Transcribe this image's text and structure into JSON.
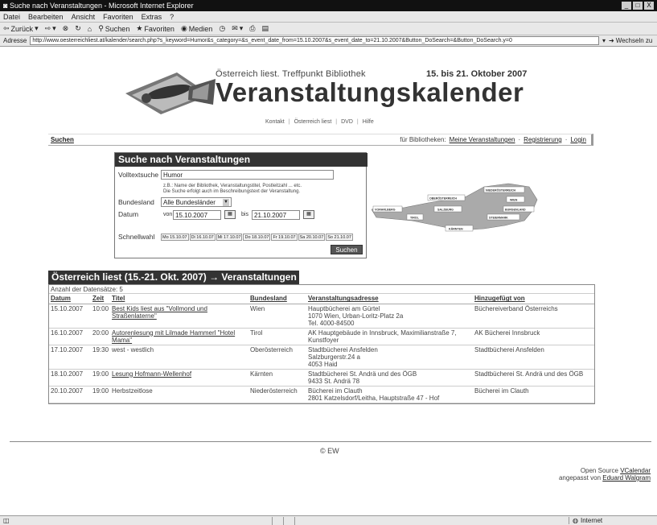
{
  "window": {
    "title": "Suche nach Veranstaltungen - Microsoft Internet Explorer",
    "controls": [
      "_",
      "□",
      "X"
    ]
  },
  "menu": [
    "Datei",
    "Bearbeiten",
    "Ansicht",
    "Favoriten",
    "Extras",
    "?"
  ],
  "toolbar": {
    "back": "Zurück",
    "search": "Suchen",
    "favorites": "Favoriten",
    "media": "Medien"
  },
  "addressbar": {
    "label": "Adresse",
    "url": "http://www.oesterreichliest.at/kalender/search.php?s_keyword=Humor&s_category=&s_event_date_from=15.10.2007&s_event_date_to=21.10.2007&Button_DoSearch=&Button_DoSearch.y=0",
    "go": "Wechseln zu"
  },
  "status": {
    "left": "",
    "zone": "Internet"
  },
  "header": {
    "subtitle": "Österreich liest. Treffpunkt Bibliothek",
    "dates": "15. bis 21. Oktober 2007",
    "title": "Veranstaltungskalender",
    "nav": [
      "Kontakt",
      "Österreich liest",
      "DVD",
      "Hilfe"
    ]
  },
  "navbar": {
    "search": "Suchen",
    "for_libraries": "für Bibliotheken:",
    "links": [
      "Meine Veranstaltungen",
      "Registrierung",
      "Login"
    ]
  },
  "search": {
    "title": "Suche nach Veranstaltungen",
    "fulltext_label": "Volltextsuche",
    "fulltext_value": "Humor",
    "hint_line1": "z.B.: Name der Bibliothek, Veranstaltungstitel, Postleitzahl ... etc.",
    "hint_line2": "Die Suche erfolgt auch im Beschreibungstext der Veranstaltung.",
    "state_label": "Bundesland",
    "state_value": "Alle Bundesländer",
    "date_label": "Datum",
    "from_label": "von",
    "from_value": "15.10.2007",
    "to_label": "bis",
    "to_value": "21.10.2007",
    "quick_label": "Schnellwahl",
    "quick_options": [
      "Mo 15.10.07",
      "Di 16.10.07",
      "Mi 17.10.07",
      "Do 18.10.07",
      "Fr 19.10.07",
      "Sa 20.10.07",
      "So 21.10.07"
    ],
    "submit": "Suchen"
  },
  "map": {
    "regions": [
      "NIEDERÖSTERREICH",
      "OBERÖSTERREICH",
      "WIEN",
      "VORARLBERG",
      "SALZBURG",
      "BURGENLAND",
      "TIROL",
      "STEIERMARK",
      "KÄRNTEN"
    ]
  },
  "results": {
    "title": "Österreich liest (15.-21. Okt. 2007) → Veranstaltungen",
    "count_label": "Anzahl der Datensätze:",
    "count": "5",
    "columns": [
      "Datum",
      "Zeit",
      "Titel",
      "Bundesland",
      "Veranstaltungsadresse",
      "Hinzugefügt von"
    ],
    "rows": [
      {
        "date": "15.10.2007",
        "time": "10:00",
        "title": "Best Kids liest aus \"Vollmond und Straßenlaterne\"",
        "title_link": true,
        "state": "Wien",
        "address": [
          "Hauptbücherei am Gürtel",
          "1070 Wien, Urban-Loritz-Platz 2a",
          "Tel. 4000-84500"
        ],
        "added_by": "Büchereiverband Österreichs"
      },
      {
        "date": "16.10.2007",
        "time": "20:00",
        "title": "Autorenlesung mit Lilmade Hammerl \"Hotel Mama\"",
        "title_link": true,
        "state": "Tirol",
        "address": [
          "AK Hauptgebäude in Innsbruck, Maximilianstraße 7,",
          "Kunstfoyer"
        ],
        "added_by": "AK Bücherei Innsbruck"
      },
      {
        "date": "17.10.2007",
        "time": "19:30",
        "title": "west - westlich",
        "title_link": false,
        "state": "Oberösterreich",
        "address": [
          "Stadtbücherei Ansfelden",
          "Salzburgerstr.24 a",
          "4053 Haid"
        ],
        "added_by": "Stadtbücherei Ansfelden"
      },
      {
        "date": "18.10.2007",
        "time": "19:00",
        "title": "Lesung Hofmann-Wellenhof",
        "title_link": true,
        "state": "Kärnten",
        "address": [
          "Stadtbücherei St. Andrä und des ÖGB",
          "9433 St. Andrä 78"
        ],
        "added_by": "Stadtbücherei St. Andrä und des ÖGB"
      },
      {
        "date": "20.10.2007",
        "time": "19:00",
        "title": "Herbstzeitlose",
        "title_link": false,
        "state": "Niederösterreich",
        "address": [
          "Bücherei im Clauth",
          "2801 Katzelsdorf/Leitha, Hauptstraße 47 - Hof"
        ],
        "added_by": "Bücherei im Clauth"
      }
    ]
  },
  "footer": {
    "ew": "© EW",
    "credit_line1": "Open Source",
    "credit_link1": "VCalendar",
    "credit_line2": "angepasst von",
    "credit_link2": "Eduard Walgram"
  }
}
